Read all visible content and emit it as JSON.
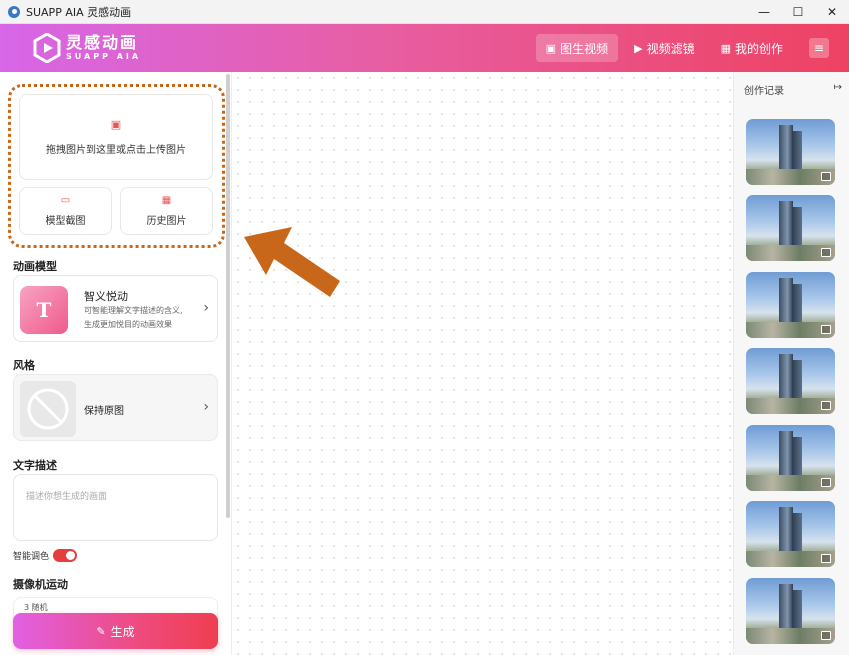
{
  "window": {
    "title": "SUAPP AIA 灵感动画",
    "minimize_glyph": "—",
    "maximize_glyph": "☐",
    "close_glyph": "✕"
  },
  "brand": {
    "name_cn": "灵感动画",
    "name_en": "SUAPP AIA"
  },
  "nav": {
    "items": [
      {
        "label": "图生视频",
        "icon": "image-icon",
        "glyph": "▣",
        "active": true
      },
      {
        "label": "视频滤镜",
        "icon": "play-circle-icon",
        "glyph": "▶",
        "active": false
      },
      {
        "label": "我的创作",
        "icon": "grid-icon",
        "glyph": "▦",
        "active": false
      }
    ],
    "menu_glyph": "≡"
  },
  "upload": {
    "text": "拖拽图片到这里或点击上传图片",
    "model_capture": "模型截图",
    "history_images": "历史图片"
  },
  "model": {
    "section": "动画模型",
    "name": "智义悦动",
    "desc_line1": "可智能理解文字描述的含义,",
    "desc_line2": "生成更加悦目的动画效果",
    "thumb_letter": "T"
  },
  "style": {
    "section": "风格",
    "name": "保持原图"
  },
  "prompt": {
    "section": "文字描述",
    "placeholder": "描述你想生成的画面"
  },
  "smart_color": {
    "label": "智能调色",
    "enabled": true
  },
  "camera": {
    "section": "摄像机运动",
    "peek": "3 随机"
  },
  "generate": {
    "label": "生成"
  },
  "history": {
    "title": "创作记录",
    "count": 7
  },
  "colors": {
    "accent_red": "#ee4263",
    "accent_pink": "#d766e8",
    "annotation_orange": "#c8661a"
  }
}
